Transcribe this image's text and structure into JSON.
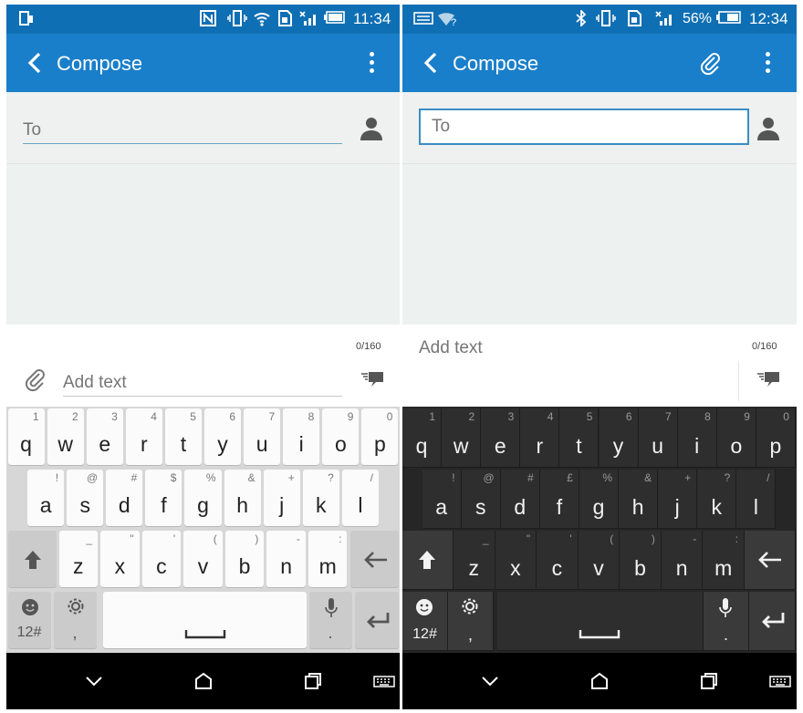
{
  "screens": [
    {
      "status": {
        "left_icons": [
          "phone-icon"
        ],
        "right_icons": [
          "nfc-icon",
          "vibrate-icon",
          "wifi-icon",
          "sim-icon",
          "signal-icon",
          "battery-icon"
        ],
        "time": "11:34",
        "battery": ""
      },
      "app_bar": {
        "title": "Compose",
        "back_icon": "back-icon",
        "menu_icon": "more-vertical-icon"
      },
      "to_placeholder": "To",
      "counter": "0/160",
      "add_text_placeholder": "Add text",
      "theme": "light"
    },
    {
      "status": {
        "left_icons": [
          "keyboard-notice-icon",
          "wifi-question-icon"
        ],
        "right_icons": [
          "bluetooth-icon",
          "vibrate-icon",
          "sim-icon",
          "signal-icon",
          "battery-icon"
        ],
        "time": "12:34",
        "battery": "56%"
      },
      "app_bar": {
        "title": "Compose",
        "back_icon": "back-icon",
        "attach_icon": "paperclip-icon",
        "menu_icon": "more-vertical-icon"
      },
      "to_placeholder": "To",
      "counter": "0/160",
      "add_text_placeholder": "Add text",
      "theme": "dark"
    }
  ],
  "keyboard": {
    "row1": [
      [
        "q",
        "1"
      ],
      [
        "w",
        "2"
      ],
      [
        "e",
        "3"
      ],
      [
        "r",
        "4"
      ],
      [
        "t",
        "5"
      ],
      [
        "y",
        "6"
      ],
      [
        "u",
        "7"
      ],
      [
        "i",
        "8"
      ],
      [
        "o",
        "9"
      ],
      [
        "p",
        "0"
      ]
    ],
    "row2_light": [
      [
        "a",
        "!"
      ],
      [
        "s",
        "@"
      ],
      [
        "d",
        "#"
      ],
      [
        "f",
        "$"
      ],
      [
        "g",
        "%"
      ],
      [
        "h",
        "&"
      ],
      [
        "j",
        "+"
      ],
      [
        "k",
        "?"
      ],
      [
        "l",
        "/"
      ]
    ],
    "row2_dark": [
      [
        "a",
        "!"
      ],
      [
        "s",
        "@"
      ],
      [
        "d",
        "#"
      ],
      [
        "f",
        "£"
      ],
      [
        "g",
        "%"
      ],
      [
        "h",
        "&"
      ],
      [
        "j",
        "+"
      ],
      [
        "k",
        "?"
      ],
      [
        "l",
        "/"
      ]
    ],
    "row3": [
      [
        "z",
        "_"
      ],
      [
        "x",
        "\""
      ],
      [
        "c",
        "'"
      ],
      [
        "v",
        "("
      ],
      [
        "b",
        ")"
      ],
      [
        "n",
        "-"
      ],
      [
        "m",
        ":"
      ]
    ],
    "symbols_label": "12#",
    "comma": ",",
    "period": "."
  },
  "colors": {
    "status_bar": "#0f6fb4",
    "app_bar": "#1a7fca",
    "accent": "#3b8cc4"
  }
}
